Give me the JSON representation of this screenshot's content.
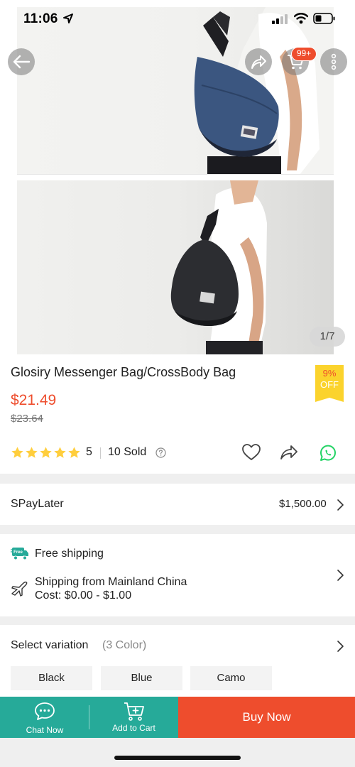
{
  "status_bar": {
    "time": "11:06"
  },
  "gallery": {
    "counter": "1/7",
    "cart_badge": "99+"
  },
  "product": {
    "title": "Glosiry Messenger Bag/CrossBody Bag",
    "discount_percent": "9%",
    "discount_label": "OFF",
    "price": "$21.49",
    "original_price": "$23.64",
    "rating": "5",
    "rating_stars": 5,
    "sold": "10 Sold"
  },
  "spaylater": {
    "label": "SPayLater",
    "amount": "$1,500.00"
  },
  "shipping": {
    "free_badge": "Free",
    "free_label": "Free shipping",
    "from_label": "Shipping from Mainland China",
    "cost_label": "Cost: $0.00 - $1.00"
  },
  "variation": {
    "title": "Select variation",
    "count": "(3 Color)",
    "options": [
      "Black",
      "Blue",
      "Camo"
    ]
  },
  "bottom_bar": {
    "chat_label": "Chat Now",
    "cart_label": "Add to Cart",
    "buy_label": "Buy Now"
  },
  "colors": {
    "brand_orange": "#ee4d2d",
    "teal": "#26aa99",
    "star": "#ffce3d",
    "discount_bg": "#fbd32d",
    "whatsapp": "#25d366"
  }
}
